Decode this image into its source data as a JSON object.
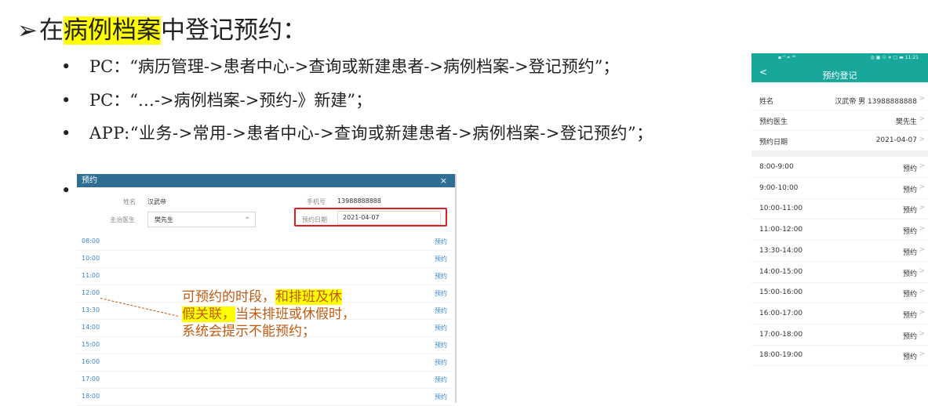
{
  "heading": {
    "arrow": "➢",
    "prefix": "在",
    "highlight": "病例档案",
    "suffix": "中登记预约："
  },
  "bullets": [
    {
      "dot": "•",
      "text": "PC：“病历管理->患者中心->查询或新建患者->病例档案->登记预约”；"
    },
    {
      "dot": "•",
      "text": "PC：“…->病例档案->预约-》新建”；"
    },
    {
      "dot": "•",
      "text": "APP:“业务->常用->患者中心->查询或新建患者->病例档案->登记预约”；"
    },
    {
      "dot": "•"
    }
  ],
  "pc_dialog": {
    "title": "预约",
    "close": "×",
    "name_label": "姓名",
    "name_value": "汉武帝",
    "phone_label": "手机号",
    "phone_value": "13988888888",
    "doctor_label": "主治医生",
    "doctor_value": "樊先生",
    "chevron": "⌄",
    "date_label": "预约日期",
    "date_value": "2021-04-07",
    "book_label": "预约",
    "slots": [
      "08:00",
      "10:00",
      "11:00",
      "12:00",
      "13:30",
      "14:00",
      "15:00",
      "16:00",
      "17:00",
      "18:00"
    ]
  },
  "annotation": {
    "line1_a": "可预约的时段，",
    "line1_hl": "和排班及休",
    "line2_hl": "假关联，",
    "line2_b": "当未排班或休假时，",
    "line3": "系统会提示不能预约；"
  },
  "mobile": {
    "status_left": "▪ ᵗˡ ≈ ⁴⁶",
    "status_right": "◎ ▣ ☉ ∗ ▢ ▬ 11:21",
    "back": "<",
    "title": "预约登记",
    "name_label": "姓名",
    "name_value": "汉武帝 男 13988888888",
    "doctor_label": "预约医生",
    "doctor_value": "樊先生",
    "date_label": "预约日期",
    "date_value": "2021-04-07",
    "chevron": ">",
    "book_label": "预约",
    "slots": [
      "8:00-9:00",
      "9:00-10:00",
      "10:00-11:00",
      "11:00-12:00",
      "13:30-14:00",
      "14:00-15:00",
      "15:00-16:00",
      "16:00-17:00",
      "17:00-18:00",
      "18:00-19:00"
    ]
  }
}
